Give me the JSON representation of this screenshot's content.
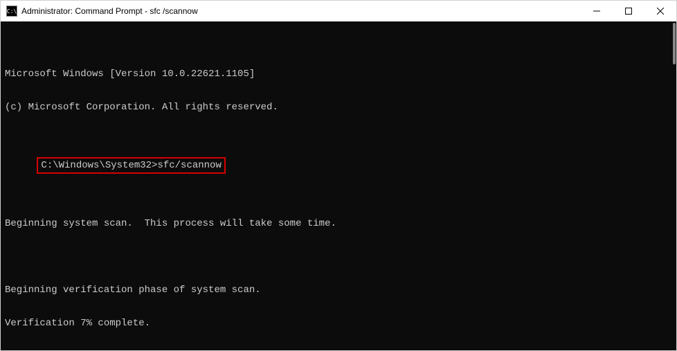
{
  "titlebar": {
    "icon_text": "C:\\",
    "title": "Administrator: Command Prompt - sfc /scannow"
  },
  "terminal": {
    "line1": "Microsoft Windows [Version 10.0.22621.1105]",
    "line2": "(c) Microsoft Corporation. All rights reserved.",
    "prompt_line": "C:\\Windows\\System32>sfc/scannow",
    "line3": "Beginning system scan.  This process will take some time.",
    "line4": "Beginning verification phase of system scan.",
    "line5": "Verification 7% complete."
  }
}
